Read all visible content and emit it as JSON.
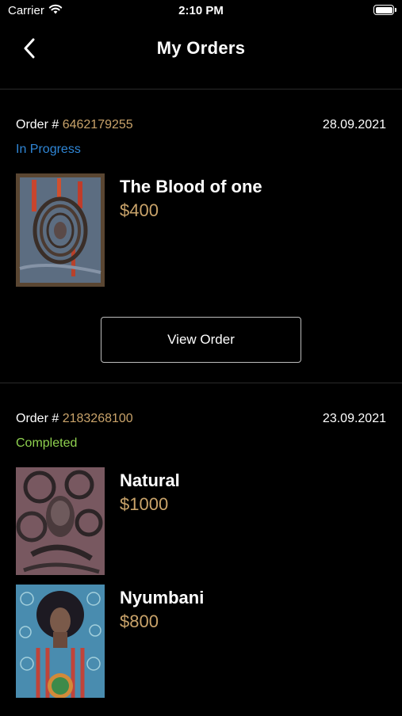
{
  "status_bar": {
    "carrier": "Carrier",
    "time": "2:10 PM"
  },
  "nav": {
    "title": "My Orders",
    "back_icon": "chevron-left-icon"
  },
  "orders": [
    {
      "label": "Order #",
      "number": "6462179255",
      "date": "28.09.2021",
      "status": "In Progress",
      "status_color": "#2f86d6",
      "items": [
        {
          "title": "The Blood of one",
          "price": "$400"
        }
      ],
      "view_button": "View Order"
    },
    {
      "label": "Order #",
      "number": "2183268100",
      "date": "23.09.2021",
      "status": "Completed",
      "status_color": "#8fd14f",
      "items": [
        {
          "title": "Natural",
          "price": "$1000"
        },
        {
          "title": "Nyumbani",
          "price": "$800"
        }
      ]
    }
  ],
  "colors": {
    "accent_gold": "#c9a36a",
    "background": "#000000"
  }
}
